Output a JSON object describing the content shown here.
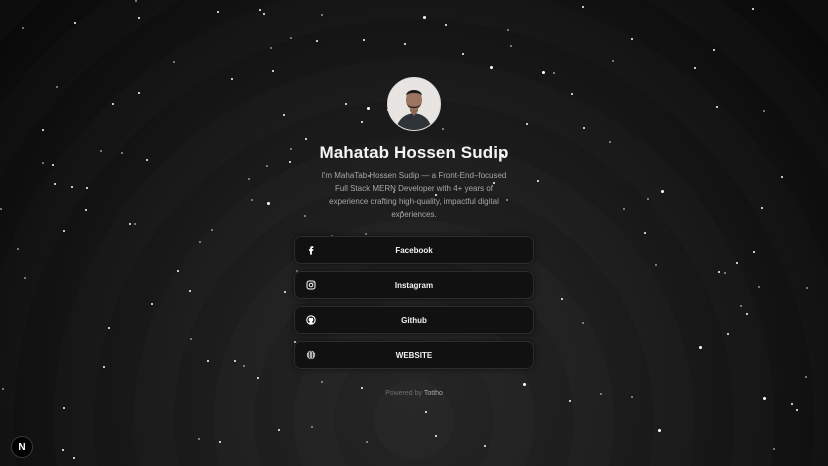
{
  "profile": {
    "name": "Mahatab Hossen Sudip",
    "bio": "I'm MahaTab Hossen Sudip — a Front-End–focused Full Stack MERN Developer with 4+ years of experience crafting high-quality, impactful digital experiences.",
    "avatar_alt": "avatar"
  },
  "links": [
    {
      "label": "Facebook",
      "icon": "facebook-icon"
    },
    {
      "label": "Instagram",
      "icon": "instagram-icon"
    },
    {
      "label": "Github",
      "icon": "github-icon"
    },
    {
      "label": "WEBSITE",
      "icon": "globe-icon"
    }
  ],
  "footer": {
    "powered_prefix": "Powered by",
    "powered_brand": "Tottho"
  },
  "badge": {
    "letter": "N",
    "icon": "nextjs-icon"
  },
  "colors": {
    "background": "#0b0b0b",
    "card": "#111111",
    "card_border": "#2c2c2c",
    "text": "#f4f4f4",
    "muted": "#a7a7a7"
  }
}
